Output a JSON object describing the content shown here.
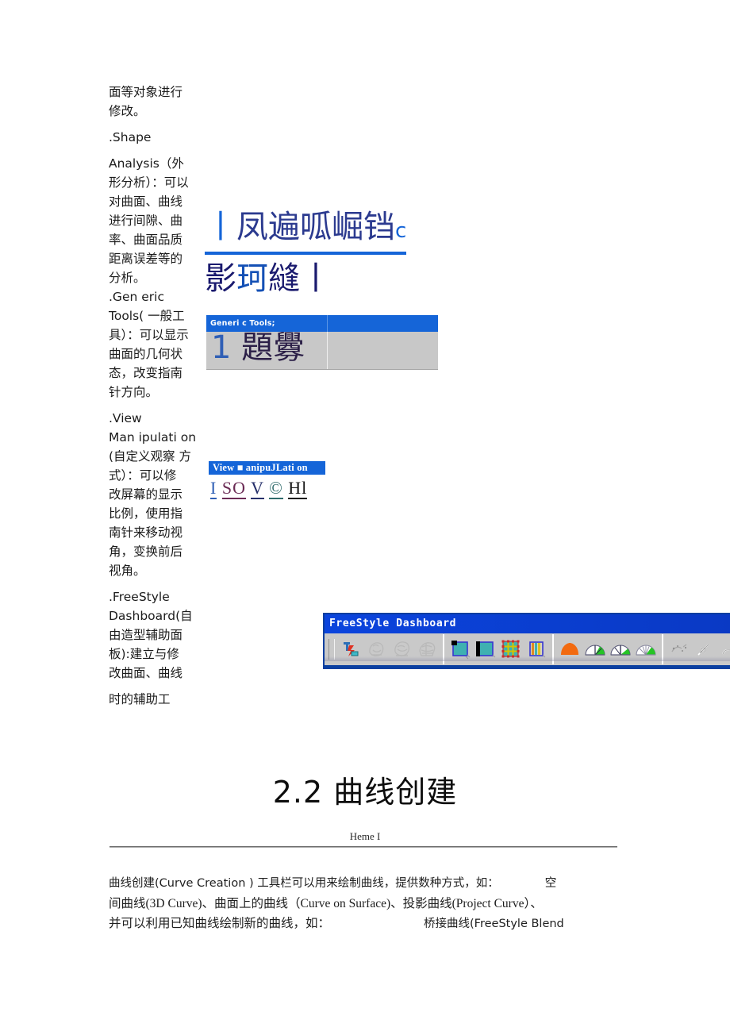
{
  "document": {
    "left_column": {
      "lines": [
        "面等对象进行",
        "修改。",
        ".Shape",
        "Analysis（外",
        "形分析）：可以",
        "对曲面、曲线",
        "进行间隙、曲",
        "率、曲面品质",
        "距离误差等的",
        "分析。",
        ".Gen eric",
        "Tools( 一般工",
        "具）：可以显示",
        "曲面的几何状",
        "态，改变指南",
        "针方向。",
        ".View",
        "Man ipulati on",
        "(自定义观察 方",
        "式）：可以修",
        "改屏幕的显示",
        "比例，使用指",
        "南针来移动视",
        "角，变换前后",
        "视角。",
        ".FreeStyle",
        "Dashboard(自",
        "由造型辅助面",
        "板):建立与修",
        "改曲面、曲线",
        "时的辅助工"
      ]
    },
    "garbled_heading": {
      "line1_lead": "丨",
      "line1_main": "凤遍呱崛铛",
      "line1_tail": "c",
      "line2_start": "影",
      "line2_mid": "珂",
      "line2_end": "縫丨"
    },
    "generic_tools_toolbar": {
      "title": "Generi c Tools;",
      "garbled_body": "1 題釁",
      "garbled_num": "1",
      "title_bar_color": "#1565d8",
      "body_color": "#c8c8c8"
    },
    "view_manipulation_toolbar": {
      "title": "View ■ anipuJLati on",
      "glyphs": [
        "I",
        "SO",
        "V",
        "©",
        "Hl"
      ],
      "title_bar_color": "#1565d8"
    },
    "freestyle_dashboard": {
      "title": "FreeStyle Dashboard",
      "title_bar_color": "#0b3fd4",
      "body_color": "#c9c9c9",
      "icons": [
        "apply-dressup-icon",
        "smooth-face-icon",
        "face-shading-icon",
        "hand-surface-icon",
        "quick-display-icon",
        "half-display-icon",
        "grid-mesh-icon",
        "stripes-display-icon",
        "orange-dome-icon",
        "green-gauge-icon",
        "green-gauge-split-icon",
        "green-gauge-dial-icon",
        "sketch-tool-icon",
        "pen-tool-icon",
        "curve-tool-icon"
      ]
    },
    "section": {
      "number": "2.2",
      "title": "曲线创建",
      "heme_label": "Heme I"
    },
    "body_paragraph": {
      "line1_a": "曲线创建(Curve Creation ) 工具栏可以用来绘制曲线，提供数种方式，如：",
      "line1_b": "空",
      "line2": "间曲线(3D Curve)、曲面上的曲线（Curve on Surface)、投影曲线(Project Curve）、",
      "line3_a": "并可以利用已知曲线绘制新的曲线，如：",
      "line3_b": "桥接曲线(FreeStyle Blend"
    }
  }
}
